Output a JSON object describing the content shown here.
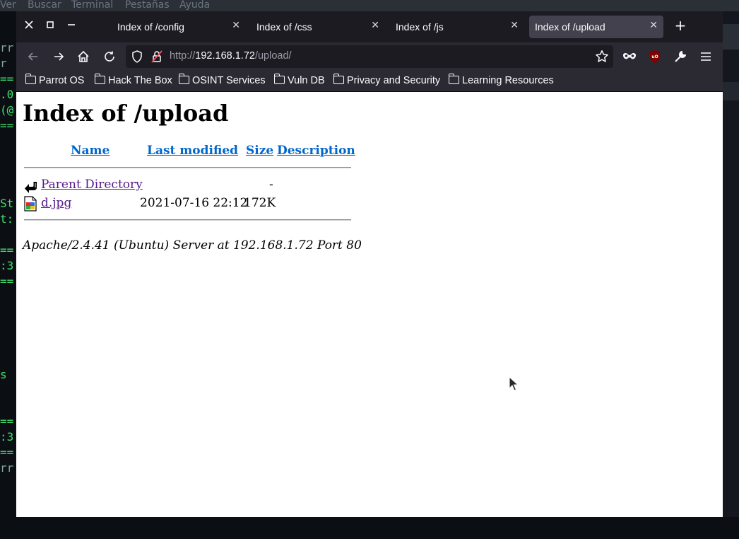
{
  "terminal": {
    "menu": [
      "Ver",
      "Buscar",
      "Terminal",
      "Pestañas",
      "Ayuda"
    ],
    "left_lines": [
      "rr",
      "r",
      "==",
      ".0",
      "(@",
      "==",
      "St",
      "t:",
      "==",
      ":3",
      "==",
      "s",
      "==",
      ":3",
      "==",
      "rr"
    ]
  },
  "browser": {
    "tabs": [
      {
        "title": "Index of /config",
        "active": false
      },
      {
        "title": "Index of /css",
        "active": false
      },
      {
        "title": "Index of /js",
        "active": false
      },
      {
        "title": "Index of /upload",
        "active": true
      }
    ],
    "url": {
      "prefix": "http://",
      "host": "192.168.1.72",
      "path": "/upload/"
    },
    "bookmarks": [
      "Parrot OS",
      "Hack The Box",
      "OSINT Services",
      "Vuln DB",
      "Privacy and Security",
      "Learning Resources"
    ]
  },
  "page": {
    "title": "Index of /upload",
    "columns": {
      "name": "Name",
      "modified": "Last modified",
      "size": "Size",
      "description": "Description"
    },
    "rows": [
      {
        "name": "Parent Directory",
        "modified": "",
        "size": "-",
        "description": ""
      },
      {
        "name": "d.jpg",
        "modified": "2021-07-16 22:12",
        "size": "172K",
        "description": ""
      }
    ],
    "footer": "Apache/2.4.41 (Ubuntu) Server at 192.168.1.72 Port 80"
  }
}
